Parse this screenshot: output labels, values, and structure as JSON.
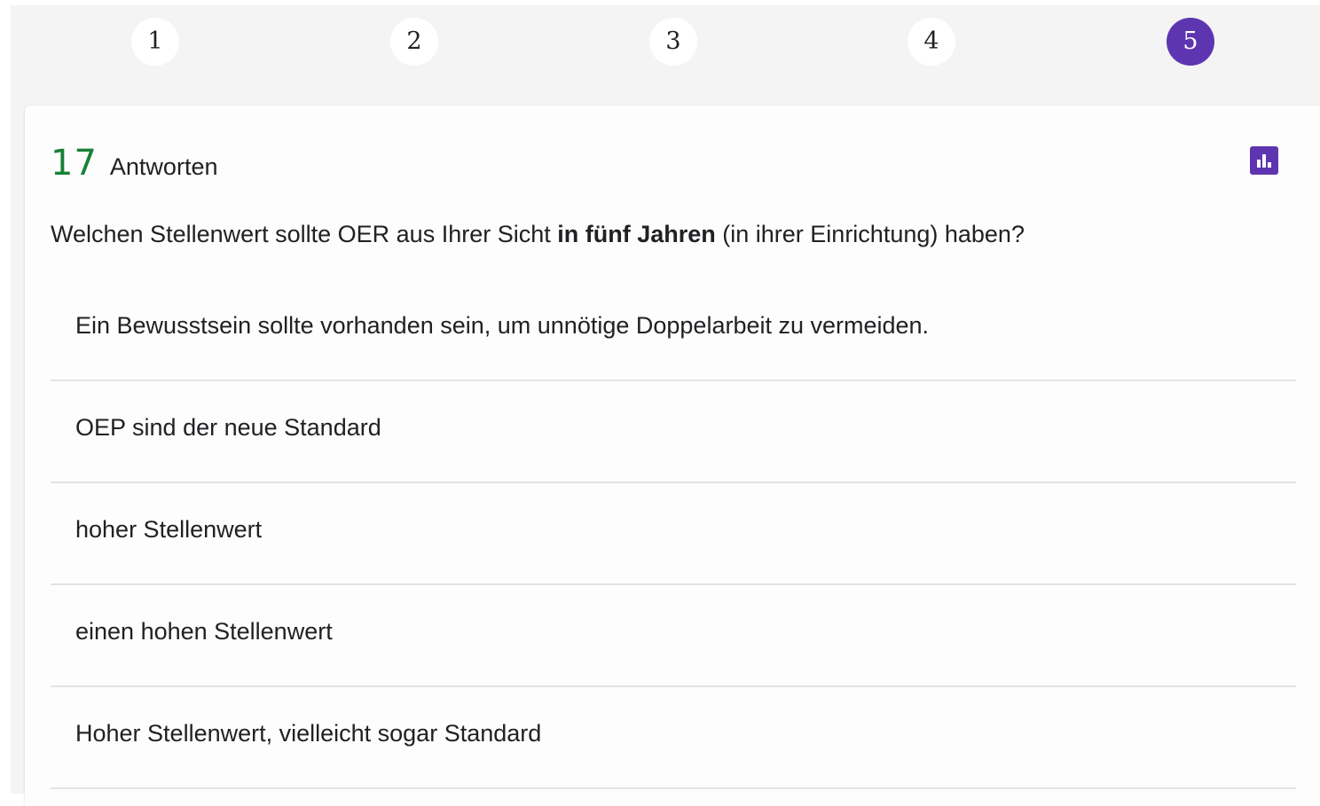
{
  "steps": [
    "1",
    "2",
    "3",
    "4",
    "5"
  ],
  "active_step": "5",
  "colors": {
    "accent": "#5e35b1",
    "count": "#188038"
  },
  "summary": {
    "count": "17",
    "label": "Antworten",
    "chart_icon": "bar-chart-icon"
  },
  "question": {
    "before": "Welchen Stellenwert sollte OER aus Ihrer Sicht ",
    "bold": "in fünf Jahren",
    "after": " (in ihrer Einrichtung) haben?"
  },
  "answers": [
    "Ein Bewusstsein sollte vorhanden sein, um unnötige Doppelarbeit zu vermeiden.",
    "OEP sind der neue Standard",
    "hoher Stellenwert",
    "einen hohen Stellenwert",
    "Hoher Stellenwert, vielleicht sogar Standard"
  ]
}
